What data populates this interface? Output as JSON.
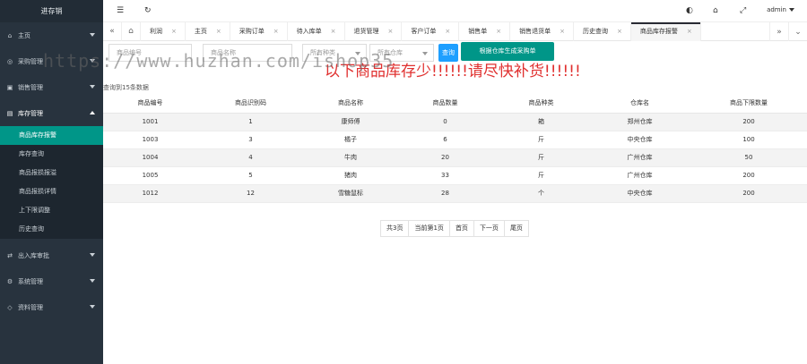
{
  "app": {
    "title": "进存销"
  },
  "sidebar": {
    "groups": [
      {
        "label": "主页",
        "icon": "home-icon"
      },
      {
        "label": "采购管理",
        "icon": "cart-icon"
      },
      {
        "label": "销售管理",
        "icon": "sales-icon"
      },
      {
        "label": "库存管理",
        "icon": "inventory-icon",
        "open": true,
        "items": [
          "商品库存报警",
          "库存查询",
          "商品报损报溢",
          "商品报损详情",
          "上下限调整",
          "历史查询"
        ]
      },
      {
        "label": "出入库审批",
        "icon": "approve-icon"
      },
      {
        "label": "系统管理",
        "icon": "settings-icon"
      },
      {
        "label": "资料管理",
        "icon": "data-icon"
      }
    ]
  },
  "topbar": {
    "user": "admin"
  },
  "tabs": [
    "利润",
    "主页",
    "采购订单",
    "待入库单",
    "退货管理",
    "客户订单",
    "销售单",
    "销售退货单",
    "历史查询",
    "商品库存报警"
  ],
  "filters": {
    "product_code_placeholder": "商品编号",
    "product_name_placeholder": "商品名称",
    "category_select": "所有种类",
    "warehouse_select": "所有仓库",
    "query_button": "查询",
    "generate_button": "根据仓库生成采购单"
  },
  "warning_text": "以下商品库存少!!!!!!请尽快补货!!!!!!",
  "watermark": "https://www.huzhan.com/ishop35",
  "result_count": "查询到15条数据",
  "table": {
    "headers": [
      "商品编号",
      "商品识别码",
      "商品名称",
      "商品数量",
      "商品种类",
      "仓库名",
      "商品下限数量"
    ],
    "rows": [
      [
        "1001",
        "1",
        "康师傅",
        "0",
        "箱",
        "郑州仓库",
        "200"
      ],
      [
        "1003",
        "3",
        "橘子",
        "6",
        "斤",
        "中央仓库",
        "100"
      ],
      [
        "1004",
        "4",
        "牛肉",
        "20",
        "斤",
        "广州仓库",
        "50"
      ],
      [
        "1005",
        "5",
        "猪肉",
        "33",
        "斤",
        "广州仓库",
        "200"
      ],
      [
        "1012",
        "12",
        "雪糖鼠标",
        "28",
        "个",
        "中央仓库",
        "200"
      ]
    ]
  },
  "pager": [
    "共3页",
    "当前第1页",
    "首页",
    "下一页",
    "尾页"
  ]
}
